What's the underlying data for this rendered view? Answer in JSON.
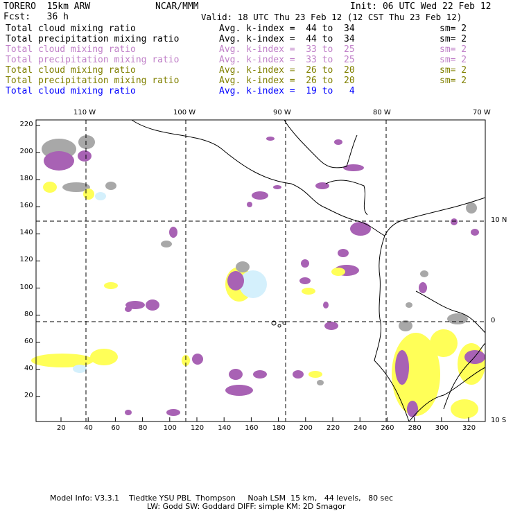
{
  "header": {
    "model": "TORERO  15km ARW",
    "org": "NCAR/MMM",
    "init": "Init: 06 UTC Wed 22 Feb 12",
    "fcst": "Fcst:   36 h",
    "valid": "Valid: 18 UTC Thu 23 Feb 12 (12 CST Thu 23 Feb 12)"
  },
  "legend": [
    {
      "field": "Total cloud mixing ratio",
      "kindex": "Avg. k-index =  44 to  34",
      "sm": "sm= 2",
      "color": "#000000"
    },
    {
      "field": "Total precipitation mixing ratio",
      "kindex": "Avg. k-index =  44 to  34",
      "sm": "sm= 2",
      "color": "#000000"
    },
    {
      "field": "Total cloud mixing ratio",
      "kindex": "Avg. k-index =  33 to  25",
      "sm": "sm= 2",
      "color": "#c080c8"
    },
    {
      "field": "Total precipitation mixing ratio",
      "kindex": "Avg. k-index =  33 to  25",
      "sm": "sm= 2",
      "color": "#c080c8"
    },
    {
      "field": "Total cloud mixing ratio",
      "kindex": "Avg. k-index =  26 to  20",
      "sm": "sm= 2",
      "color": "#808000"
    },
    {
      "field": "Total precipitation mixing ratio",
      "kindex": "Avg. k-index =  26 to  20",
      "sm": "sm= 2",
      "color": "#808000"
    },
    {
      "field": "Total cloud mixing ratio",
      "kindex": "Avg. k-index =  19 to   4",
      "sm": "",
      "color": "#0000ff"
    }
  ],
  "axes": {
    "bottom": [
      "20",
      "40",
      "60",
      "80",
      "100",
      "120",
      "140",
      "160",
      "180",
      "200",
      "220",
      "240",
      "260",
      "280",
      "300",
      "320"
    ],
    "left": [
      "20",
      "40",
      "60",
      "80",
      "100",
      "120",
      "140",
      "160",
      "180",
      "200",
      "220"
    ],
    "top": [
      "110 W",
      "100 W",
      "90 W",
      "80 W",
      "70 W"
    ],
    "right": [
      "10 N",
      "0",
      "10 S"
    ]
  },
  "footer": {
    "line1": "Model Info: V3.3.1    Tiedtke YSU PBL  Thompson     Noah LSM  15 km,   44 levels,   80 sec",
    "line2": "LW: Godd SW: Goddard DIFF: simple KM: 2D Smagor"
  },
  "colors": {
    "gray": "#a8a8a8",
    "purple": "#a862b4",
    "yellow": "#ffff58",
    "cyan": "#d4f0fc"
  }
}
